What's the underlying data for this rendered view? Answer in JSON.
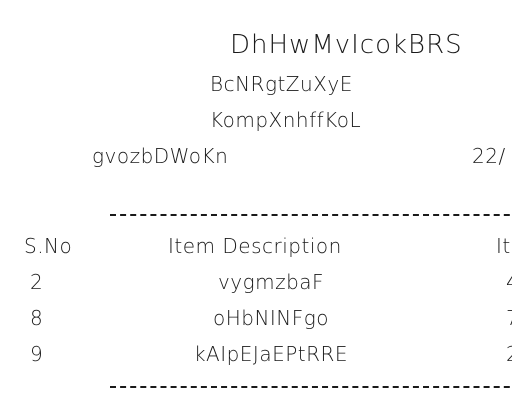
{
  "receipt": {
    "store_name": "DhHwMvIcokBRS",
    "address_line1": "BcNRgtZuXyE",
    "address_line2": "KompXnhffKoL",
    "cashier": "gvozbDWoKn",
    "date": "22/"
  },
  "table": {
    "headers": [
      "S.No",
      "Item Description",
      "It"
    ],
    "rows": [
      {
        "sno": "2",
        "description": "vygmzbaF",
        "value": "4"
      },
      {
        "sno": "8",
        "description": "oHbNINFgo",
        "value": "7"
      },
      {
        "sno": "9",
        "description": "kAIpEJaEPtRRE",
        "value": "2"
      }
    ]
  }
}
